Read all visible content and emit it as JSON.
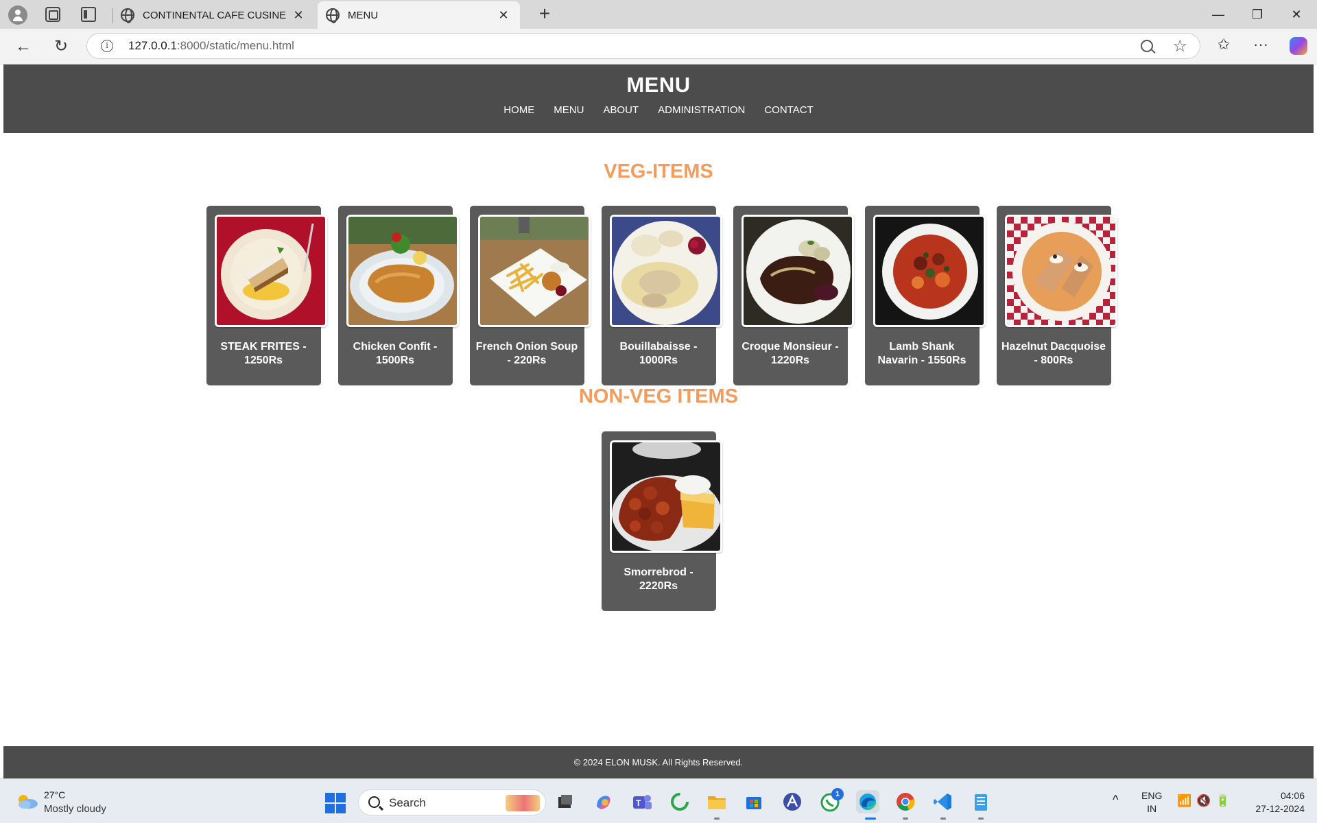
{
  "browser": {
    "tabs": [
      {
        "title": "CONTINENTAL CAFE CUSINE",
        "active": false
      },
      {
        "title": "MENU",
        "active": true
      }
    ],
    "url_host": "127.0.0.1",
    "url_rest": ":8000/static/menu.html",
    "tab_close_symbol": "✕",
    "new_tab_symbol": "+",
    "window_controls": {
      "minimize": "—",
      "maximize": "❐",
      "close": "✕"
    },
    "nav_symbols": {
      "back": "←",
      "refresh": "↻",
      "favorites": "☆",
      "collections": "✩",
      "more": "···"
    }
  },
  "site": {
    "title": "MENU",
    "nav": [
      "HOME",
      "MENU",
      "ABOUT",
      "ADMINISTRATION",
      "CONTACT"
    ],
    "veg_heading": "VEG-ITEMS",
    "nonveg_heading": "NON-VEG ITEMS",
    "veg_items": [
      {
        "name": "STEAK FRITES - 1250Rs",
        "icon": "strudel-dessert-photo"
      },
      {
        "name": "Chicken Confit - 1500Rs",
        "icon": "schnitzel-plate-photo"
      },
      {
        "name": "French Onion Soup - 220Rs",
        "icon": "fries-plate-photo"
      },
      {
        "name": "Bouillabaisse - 1000Rs",
        "icon": "dumpling-sauce-photo"
      },
      {
        "name": "Croque Monsieur - 1220Rs",
        "icon": "meat-gravy-photo"
      },
      {
        "name": "Lamb Shank Navarin - 1550Rs",
        "icon": "stew-bowl-photo"
      },
      {
        "name": "Hazelnut Dacquoise - 800Rs",
        "icon": "crepes-plate-photo"
      }
    ],
    "nonveg_items": [
      {
        "name": "Smorrebrod - 2220Rs",
        "icon": "grilled-meat-photo"
      }
    ],
    "footer": "© 2024 ELON MUSK. All Rights Reserved.",
    "colors": {
      "header_bg": "#4c4c4c",
      "heading": "#f39c5c",
      "card_bg": "#5a5a5a"
    }
  },
  "taskbar": {
    "weather_temp": "27°C",
    "weather_desc": "Mostly cloudy",
    "search_placeholder": "Search",
    "lang_line1": "ENG",
    "lang_line2": "IN",
    "time": "04:06",
    "date": "27-12-2024",
    "whatsapp_badge": "1",
    "tray_arrow": "^",
    "tray_wifi": "📶",
    "tray_volume": "🔇",
    "tray_battery": "🔋"
  }
}
